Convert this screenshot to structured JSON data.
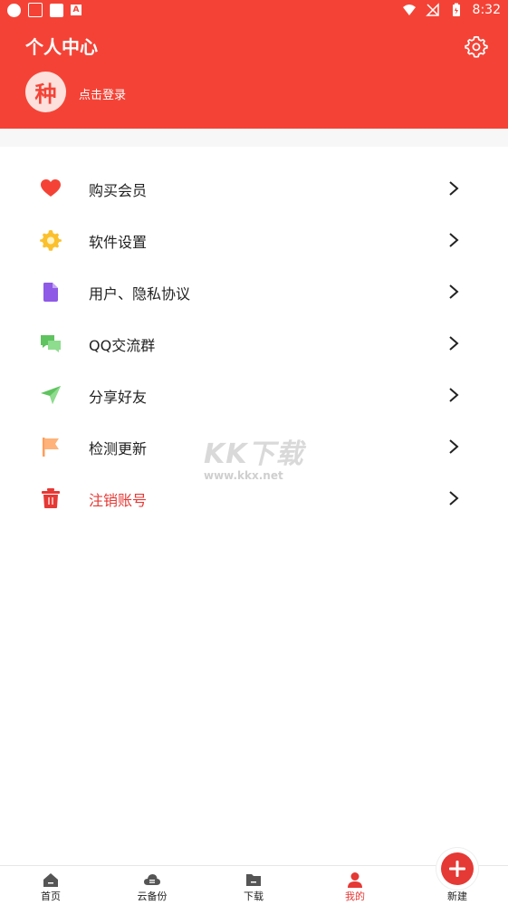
{
  "status_bar": {
    "time": "8:32",
    "left_icons": [
      "circle-icon",
      "app-badge-icon",
      "square-icon",
      "a-icon"
    ],
    "right_icons": [
      "wifi-icon",
      "no-signal-icon",
      "battery-icon"
    ]
  },
  "header": {
    "title": "个人中心",
    "avatar_text": "种",
    "login_text": "点击登录",
    "settings_icon": "gear-icon",
    "background": "#f44336"
  },
  "menu": {
    "items": [
      {
        "label": "购买会员",
        "icon": "heart-icon",
        "color": "#f44336"
      },
      {
        "label": "软件设置",
        "icon": "gear-icon",
        "color": "#fbc02d"
      },
      {
        "label": "用户、隐私协议",
        "icon": "document-icon",
        "color": "#8e5ae6"
      },
      {
        "label": "QQ交流群",
        "icon": "chat-icon",
        "color": "#5fc35f"
      },
      {
        "label": "分享好友",
        "icon": "paper-plane-icon",
        "color": "#5fc35f"
      },
      {
        "label": "检测更新",
        "icon": "flag-icon",
        "color": "#ff9e5a"
      },
      {
        "label": "注销账号",
        "icon": "trash-icon",
        "color": "#e53935"
      }
    ]
  },
  "watermark": {
    "big": "KK下载",
    "small": "www.kkx.net"
  },
  "bottom_nav": {
    "items": [
      {
        "label": "首页",
        "icon": "home-icon",
        "active": false
      },
      {
        "label": "云备份",
        "icon": "cloud-icon",
        "active": false
      },
      {
        "label": "下载",
        "icon": "folder-icon",
        "active": false
      },
      {
        "label": "我的",
        "icon": "user-icon",
        "active": true
      },
      {
        "label": "新建",
        "icon": "plus-icon",
        "active": false
      }
    ],
    "accent": "#e53935"
  }
}
